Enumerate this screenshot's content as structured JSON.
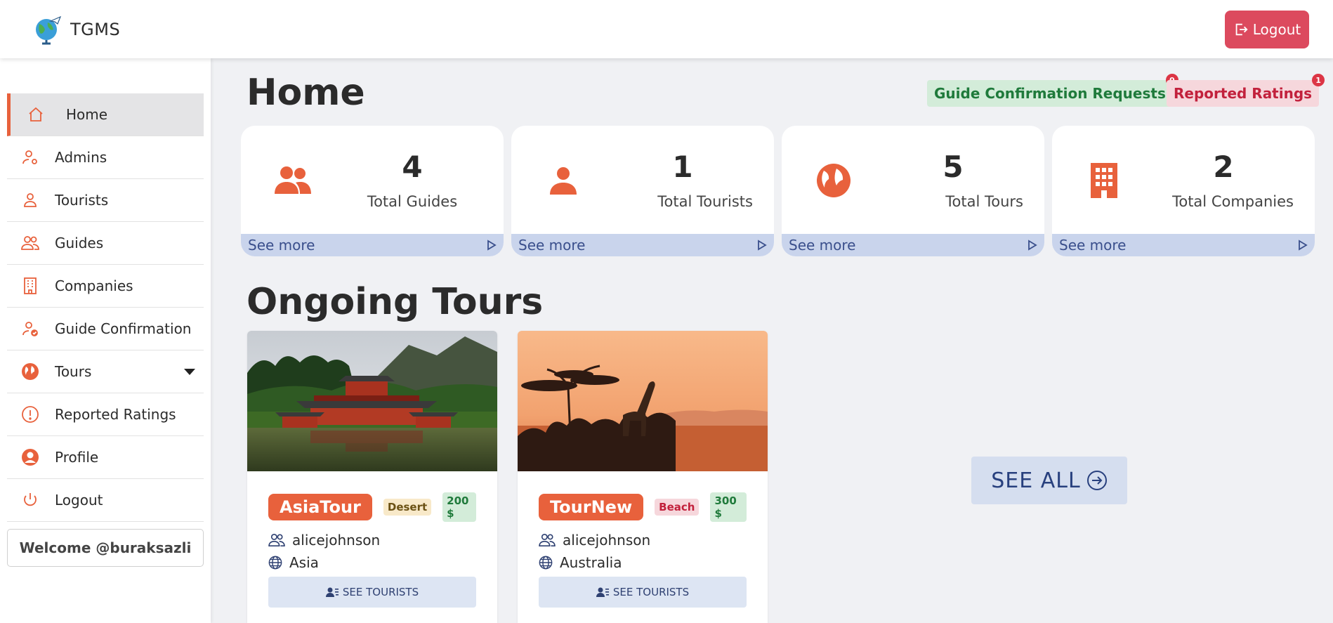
{
  "app": {
    "name": "TGMS",
    "logout_label": "Logout"
  },
  "sidebar": {
    "items": [
      {
        "label": "Home",
        "icon": "home-icon"
      },
      {
        "label": "Admins",
        "icon": "user-gear-icon"
      },
      {
        "label": "Tourists",
        "icon": "user-icon"
      },
      {
        "label": "Guides",
        "icon": "users-icon"
      },
      {
        "label": "Companies",
        "icon": "building-icon"
      },
      {
        "label": "Guide Confirmation",
        "icon": "user-check-icon"
      },
      {
        "label": "Tours",
        "icon": "globe-icon"
      },
      {
        "label": "Reported Ratings",
        "icon": "exclamation-circle-icon"
      },
      {
        "label": "Profile",
        "icon": "user-circle-icon"
      },
      {
        "label": "Logout",
        "icon": "power-icon"
      }
    ],
    "active": "Home",
    "welcome": "Welcome @buraksazli"
  },
  "header": {
    "title": "Home",
    "guide_requests": {
      "label": "Guide Confirmation Requests",
      "count": "0"
    },
    "reported_ratings": {
      "label": "Reported Ratings",
      "count": "1"
    }
  },
  "stats": [
    {
      "value": "4",
      "label": "Total Guides",
      "link": "See more",
      "icon": "users-icon"
    },
    {
      "value": "1",
      "label": "Total Tourists",
      "link": "See more",
      "icon": "user-icon"
    },
    {
      "value": "5",
      "label": "Total Tours",
      "link": "See more",
      "icon": "globe-icon"
    },
    {
      "value": "2",
      "label": "Total Companies",
      "link": "See more",
      "icon": "building-icon"
    }
  ],
  "ongoing": {
    "title": "Ongoing Tours",
    "tours": [
      {
        "name": "AsiaTour",
        "tag": "Desert",
        "price": "200 $",
        "guide": "alicejohnson",
        "location": "Asia",
        "button": "SEE TOURISTS"
      },
      {
        "name": "TourNew",
        "tag": "Beach",
        "price": "300 $",
        "guide": "alicejohnson",
        "location": "Australia",
        "button": "SEE TOURISTS"
      }
    ],
    "see_all": "SEE ALL"
  },
  "colors": {
    "accent": "#e8613c",
    "danger": "#dc4a5e",
    "link_bar": "#c9d4ec",
    "success_bg": "#d3ecd9"
  }
}
